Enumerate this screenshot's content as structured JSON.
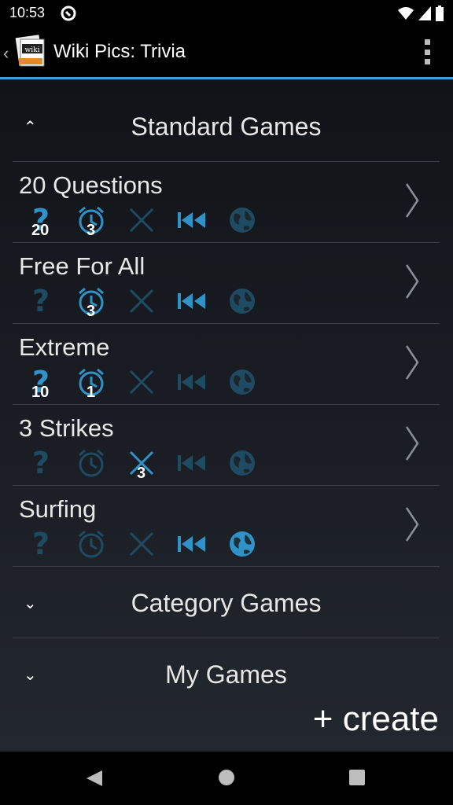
{
  "status": {
    "time": "10:53"
  },
  "app": {
    "title": "Wiki Pics: Trivia",
    "icon_text": "wiki"
  },
  "sections": {
    "standard": "Standard Games",
    "category": "Category Games",
    "mine": "My Games"
  },
  "games": [
    {
      "name": "20 Questions",
      "q": "20",
      "clock": "3",
      "x": "",
      "active": {
        "q": true,
        "clock": true,
        "x": false,
        "rewind": true,
        "globe": false
      }
    },
    {
      "name": "Free For All",
      "q": "",
      "clock": "3",
      "x": "",
      "active": {
        "q": false,
        "clock": true,
        "x": false,
        "rewind": true,
        "globe": false
      }
    },
    {
      "name": "Extreme",
      "q": "10",
      "clock": "1",
      "x": "",
      "active": {
        "q": true,
        "clock": true,
        "x": false,
        "rewind": false,
        "globe": false
      }
    },
    {
      "name": "3 Strikes",
      "q": "",
      "clock": "",
      "x": "3",
      "active": {
        "q": false,
        "clock": false,
        "x": true,
        "rewind": false,
        "globe": false
      }
    },
    {
      "name": "Surfing",
      "q": "",
      "clock": "",
      "x": "",
      "active": {
        "q": false,
        "clock": false,
        "x": false,
        "rewind": true,
        "globe": true
      }
    }
  ],
  "create_label": "+ create",
  "colors": {
    "accent": "#35a3d6",
    "active_icon": "#2f93c8",
    "dim_icon": "#1f4b62"
  }
}
